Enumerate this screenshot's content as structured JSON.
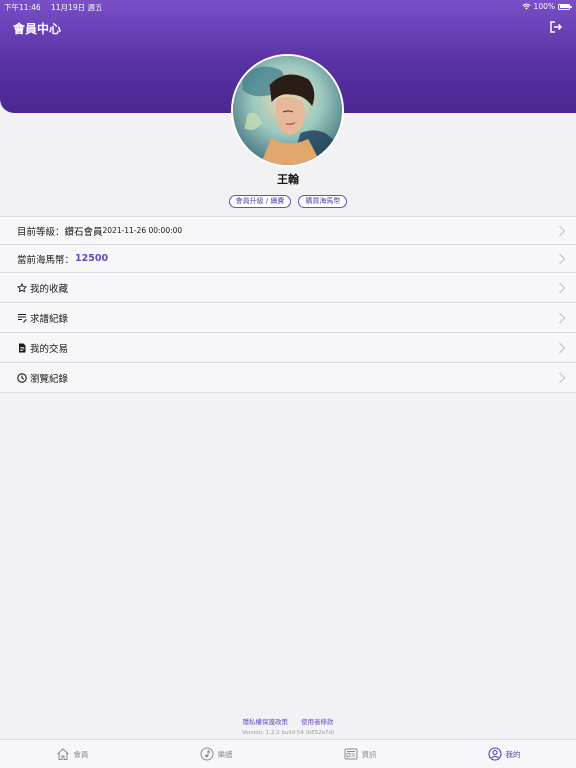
{
  "status_bar": {
    "time": "下午11:46",
    "date": "11月19日 週五",
    "battery": "100%"
  },
  "header": {
    "title": "會員中心",
    "logout_icon": "logout-icon"
  },
  "profile": {
    "name": "王翰",
    "buttons": {
      "upgrade": "會員升級 / 續費",
      "buy_coins": "購買海馬幣"
    }
  },
  "menu": {
    "level_label": "目前等級：鑽石會員",
    "level_date": "2021-11-26 00:00:00",
    "coins_label": "當前海馬幣：",
    "coins_value": "12500",
    "favorites": "我的收藏",
    "requests": "求譜紀錄",
    "transactions": "我的交易",
    "history": "瀏覽紀錄"
  },
  "footer": {
    "privacy": "隱私權保護政策",
    "terms": "使用者條款",
    "version": "Version: 1.2.2 build 54 (b852e7d)"
  },
  "tabbar": {
    "tabs": [
      {
        "label": "會員",
        "icon": "home-icon"
      },
      {
        "label": "樂譜",
        "icon": "music-note-icon"
      },
      {
        "label": "資訊",
        "icon": "news-icon"
      },
      {
        "label": "我的",
        "icon": "user-circle-icon"
      }
    ],
    "active_index": 3
  },
  "colors": {
    "header_top": "#7a4fc8",
    "header_bottom": "#4a2890",
    "accent": "#6247c6"
  }
}
